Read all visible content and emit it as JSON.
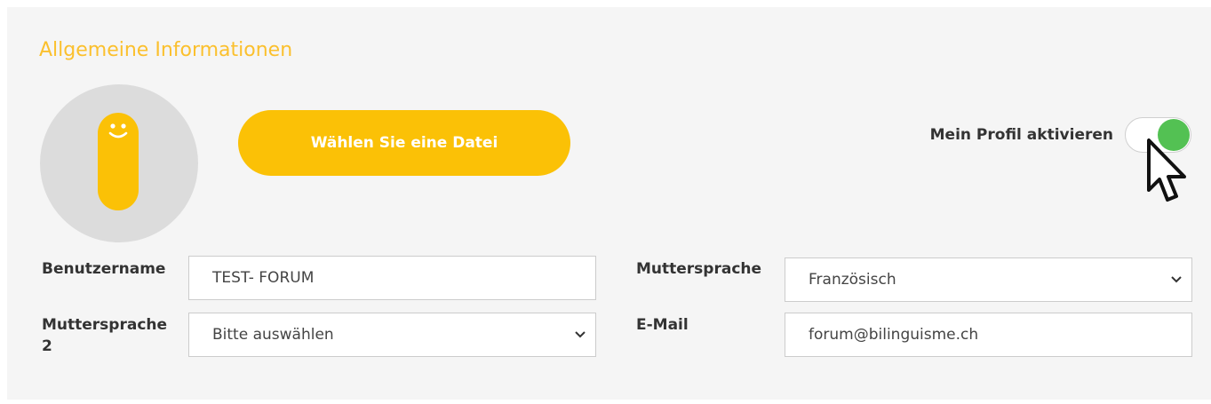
{
  "section": {
    "title": "Allgemeine Informationen"
  },
  "avatar": {
    "icon": "smiley-mascot-icon",
    "color": "#fbc106"
  },
  "upload": {
    "label": "Wählen Sie eine Datei"
  },
  "profile_toggle": {
    "label": "Mein Profil aktivieren",
    "state": "on",
    "on_color": "#53c153"
  },
  "form": {
    "username": {
      "label": "Benutzername",
      "value": "TEST- FORUM"
    },
    "mother_tongue": {
      "label": "Muttersprache",
      "value": "Französisch"
    },
    "mother_tongue_2": {
      "label_line1": "Muttersprache",
      "label_line2": "2",
      "value": "Bitte auswählen"
    },
    "email": {
      "label": "E-Mail",
      "value": "forum@bilinguisme.ch"
    }
  },
  "colors": {
    "accent": "#fbc106",
    "title": "#fbc02d",
    "toggle_on": "#53c153",
    "panel_bg": "#f5f5f5"
  }
}
